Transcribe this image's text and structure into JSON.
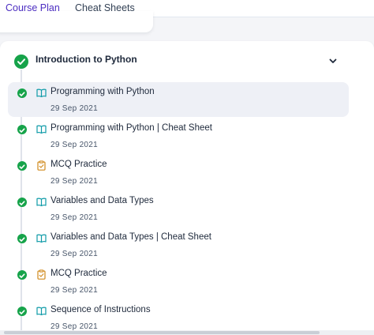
{
  "tabs": [
    {
      "label": "Course Plan",
      "active": true
    },
    {
      "label": "Cheat Sheets",
      "active": false
    }
  ],
  "section": {
    "title": "Introduction to Python",
    "completed": true,
    "expanded": true
  },
  "items": [
    {
      "title": "Programming with Python",
      "date": "29 Sep 2021",
      "icon": "book-icon",
      "completed": true,
      "selected": true
    },
    {
      "title": "Programming with Python | Cheat Sheet",
      "date": "29 Sep 2021",
      "icon": "book-icon",
      "completed": true,
      "selected": false
    },
    {
      "title": "MCQ Practice",
      "date": "29 Sep 2021",
      "icon": "clipboard-icon",
      "completed": true,
      "selected": false
    },
    {
      "title": "Variables and Data Types",
      "date": "29 Sep 2021",
      "icon": "book-icon",
      "completed": true,
      "selected": false
    },
    {
      "title": "Variables and Data Types | Cheat Sheet",
      "date": "29 Sep 2021",
      "icon": "book-icon",
      "completed": true,
      "selected": false
    },
    {
      "title": "MCQ Practice",
      "date": "29 Sep 2021",
      "icon": "clipboard-icon",
      "completed": true,
      "selected": false
    },
    {
      "title": "Sequence of Instructions",
      "date": "29 Sep 2021",
      "icon": "book-icon",
      "completed": true,
      "selected": false
    }
  ],
  "colors": {
    "accent": "#4c2ec2",
    "success": "#16a34a",
    "book_icon": "#0f9ba8",
    "clipboard_icon": "#d08a1c",
    "selected_row": "#eef0f6"
  }
}
